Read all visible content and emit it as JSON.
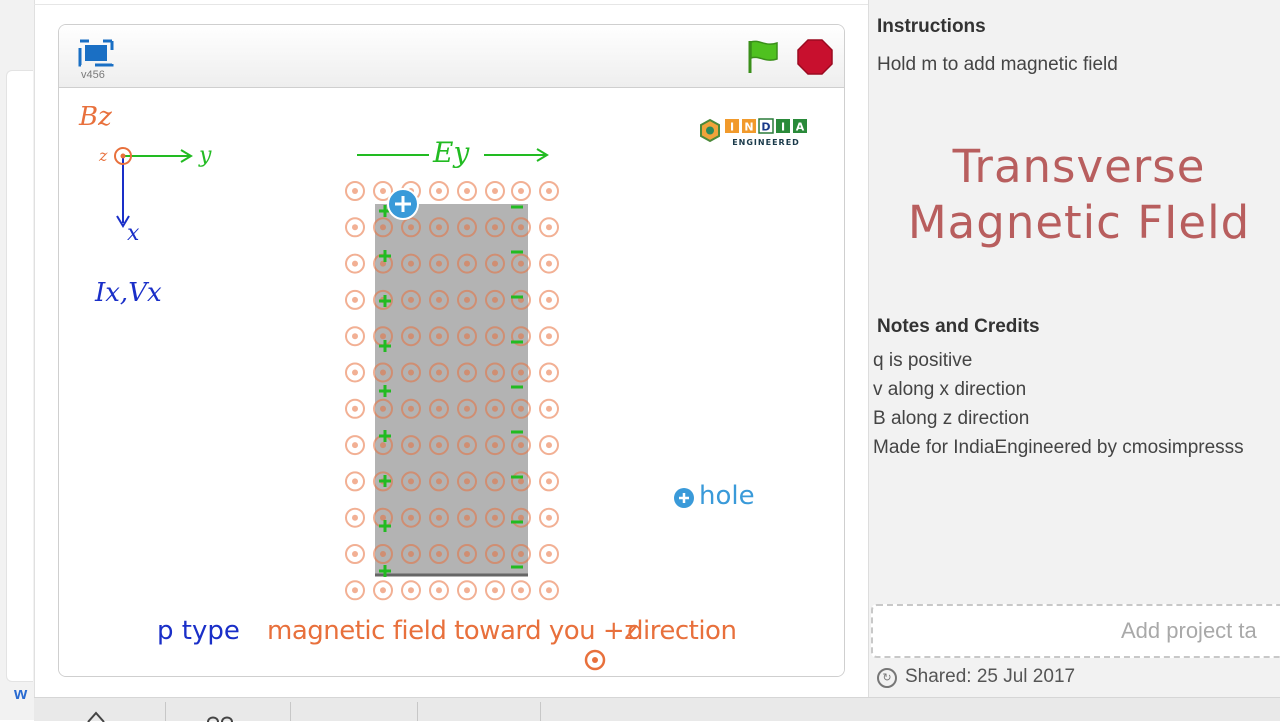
{
  "player": {
    "version": "v456"
  },
  "stage": {
    "bz_label": "Bz",
    "z_label": "z",
    "y_label": "y",
    "x_label": "x",
    "ix_vx_label": "Ix,Vx",
    "ey_label": "Ey",
    "legend_hole_label": "hole",
    "p_type_label": "p type",
    "field_caption": "magnetic field toward you +z",
    "direction_label": "direction",
    "logo_text": "INDIA",
    "logo_subtext": "ENGINEERED",
    "colors": {
      "orange": "#e8703c",
      "green": "#22bb22",
      "blue": "#1a2fc8",
      "hole_blue": "#3a9ad9",
      "slab": "#b3b3b3"
    }
  },
  "sidebar": {
    "instructions_heading": "Instructions",
    "instructions_text": "Hold m to add magnetic field",
    "title_line1": "Transverse",
    "title_line2": "Magnetic FIeld",
    "notes_heading": "Notes and Credits",
    "notes": [
      "q is positive",
      "v along x direction",
      "B along z direction",
      "Made for IndiaEngineered by cmosimpresss"
    ],
    "tags_placeholder": "Add project ta",
    "shared_label": "Shared: 25 Jul 2017"
  }
}
